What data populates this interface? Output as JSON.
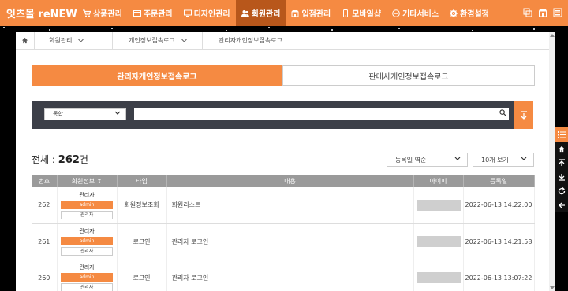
{
  "header": {
    "logo": "잇츠몰 reNEW",
    "menu": [
      {
        "label": "상품관리",
        "icon": "cart-icon"
      },
      {
        "label": "주문관리",
        "icon": "card-icon"
      },
      {
        "label": "디자인관리",
        "icon": "monitor-icon"
      },
      {
        "label": "회원관리",
        "icon": "users-icon",
        "active": true
      },
      {
        "label": "입점관리",
        "icon": "store-icon"
      },
      {
        "label": "모바일샵",
        "icon": "mobile-icon"
      },
      {
        "label": "기타서비스",
        "icon": "minus-circle-icon"
      },
      {
        "label": "환경설정",
        "icon": "gear-icon"
      }
    ]
  },
  "breadcrumb": [
    "회원관리",
    "개인정보접속로그",
    "관리자개인정보접속로그"
  ],
  "tabs": [
    "관리자개인정보접속로그",
    "판매사개인정보접속로그"
  ],
  "search": {
    "select_value": "통합",
    "input_value": ""
  },
  "total": {
    "label": "전체 :",
    "count": "262",
    "unit": "건"
  },
  "sort": {
    "order": "등록일 역순",
    "page_size": "10개 보기"
  },
  "table": {
    "headers": [
      "번호",
      "회원정보 ↕",
      "타입",
      "내용",
      "아이피",
      "등록일"
    ],
    "rows": [
      {
        "no": "262",
        "role": "관리자",
        "id": "admin",
        "btn": "관리자",
        "type": "회원정보조회",
        "content": "회원리스트",
        "date": "2022-06-13 14:22:00"
      },
      {
        "no": "261",
        "role": "관리자",
        "id": "admin",
        "btn": "관리자",
        "type": "로그인",
        "content": "관리자 로그인",
        "date": "2022-06-13 14:21:58"
      },
      {
        "no": "260",
        "role": "관리자",
        "id": "admin",
        "btn": "관리자",
        "type": "로그인",
        "content": "관리자 로그인",
        "date": "2022-06-13 13:07:22"
      }
    ]
  },
  "colors": {
    "accent": "#f58a42",
    "dark": "#3c3f48",
    "header_gray": "#9a9a9a"
  }
}
